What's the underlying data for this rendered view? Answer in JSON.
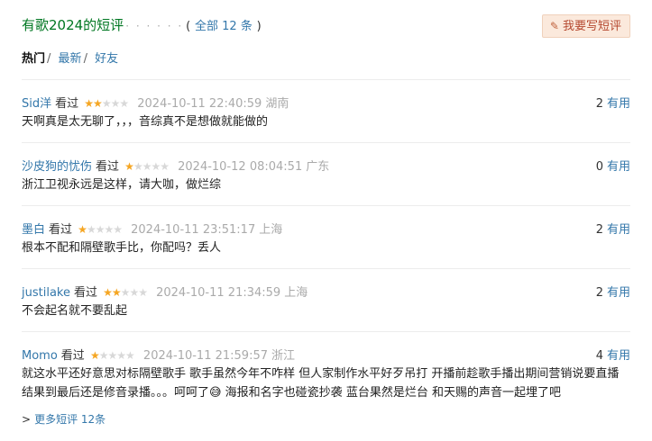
{
  "header": {
    "title": "有歌2024的短评",
    "dots": "· · · · · ·",
    "open_paren": "(",
    "all_label": "全部 12 条",
    "close_paren": ")",
    "write_button": "我要写短评"
  },
  "tabs": [
    {
      "label": "热门",
      "sep": "/"
    },
    {
      "label": "最新",
      "sep": "/"
    },
    {
      "label": "好友",
      "sep": ""
    }
  ],
  "comments": [
    {
      "user": "Sid洋",
      "watched": "看过",
      "rating": 2,
      "time": "2024-10-11 22:40:59",
      "location": "湖南",
      "text": "天啊真是太无聊了，，，音综真不是想做就能做的",
      "useful_count": "2",
      "useful_label": "有用"
    },
    {
      "user": "沙皮狗的忧伤",
      "watched": "看过",
      "rating": 1,
      "time": "2024-10-12 08:04:51",
      "location": "广东",
      "text": "浙江卫视永远是这样，请大咖，做烂综",
      "useful_count": "0",
      "useful_label": "有用"
    },
    {
      "user": "墨白",
      "watched": "看过",
      "rating": 1,
      "time": "2024-10-11 23:51:17",
      "location": "上海",
      "text": "根本不配和隔壁歌手比，你配吗？丢人",
      "useful_count": "2",
      "useful_label": "有用"
    },
    {
      "user": "justilake",
      "watched": "看过",
      "rating": 2,
      "time": "2024-10-11 21:34:59",
      "location": "上海",
      "text": "不会起名就不要乱起",
      "useful_count": "2",
      "useful_label": "有用"
    },
    {
      "user": "Momo",
      "watched": "看过",
      "rating": 1,
      "time": "2024-10-11 21:59:57",
      "location": "浙江",
      "text_line1": "就这水平还好意思对标隔壁歌手 歌手虽然今年不咋样 但人家制作水平好歹吊打 开播前趁歌手播出期间营销说要直播",
      "text_line2": "结果到最后还是修音录播。。。呵呵了😅 海报和名字也碰瓷抄袭 蓝台果然是烂台 和天赐的声音一起埋了吧",
      "useful_count": "4",
      "useful_label": "有用"
    }
  ],
  "more": {
    "arrow": ">",
    "label": "更多短评 12条"
  }
}
